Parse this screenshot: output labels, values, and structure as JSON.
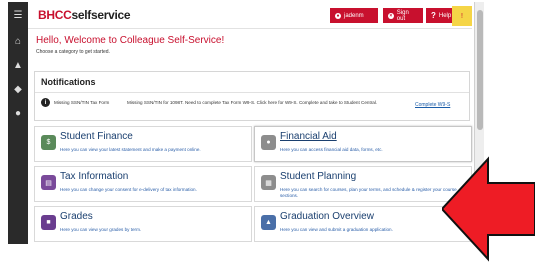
{
  "brand": {
    "part1": "BHCC",
    "part2": "selfservice"
  },
  "topbar": {
    "user": "jadenm",
    "signout": "Sign out",
    "help": "Help",
    "yellow_icon": "!"
  },
  "welcome": {
    "title": "Hello, Welcome to Colleague Self-Service!",
    "subtitle": "Choose a category to get started."
  },
  "notifications": {
    "title": "Notifications",
    "items": [
      {
        "label": "Missing SSN/TIN Tax Form",
        "message": "Missing SSN/TIN for 1098T. Need to complete Tax Form W9-S. Click here for W9-S. Complete and take to Student Central.",
        "action": "Complete W9-S"
      }
    ]
  },
  "cards": [
    {
      "title": "Student Finance",
      "desc": "Here you can view your latest statement and make a payment online.",
      "icon": "dollar-icon",
      "color": "#5a8a5a"
    },
    {
      "title": "Financial Aid",
      "desc": "Here you can access financial aid data, forms, etc.",
      "icon": "piggy-bank-icon",
      "color": "#8d8d8d"
    },
    {
      "title": "Tax Information",
      "desc": "Here you can change your consent for e-delivery of tax information.",
      "icon": "document-icon",
      "color": "#7a4a9a"
    },
    {
      "title": "Student Planning",
      "desc": "Here you can search for courses, plan your terms, and schedule & register your course sections.",
      "icon": "calendar-icon",
      "color": "#8d8d8d"
    },
    {
      "title": "Grades",
      "desc": "Here you can view your grades by term.",
      "icon": "grades-icon",
      "color": "#6a3d8f"
    },
    {
      "title": "Graduation Overview",
      "desc": "Here you can view and submit a graduation application.",
      "icon": "graduation-icon",
      "color": "#4a6fa8"
    }
  ],
  "colors": {
    "accent": "#c8102e",
    "sidebar": "#2a2a2a",
    "arrow": "#ee1c25",
    "link": "#1a5ca8"
  }
}
